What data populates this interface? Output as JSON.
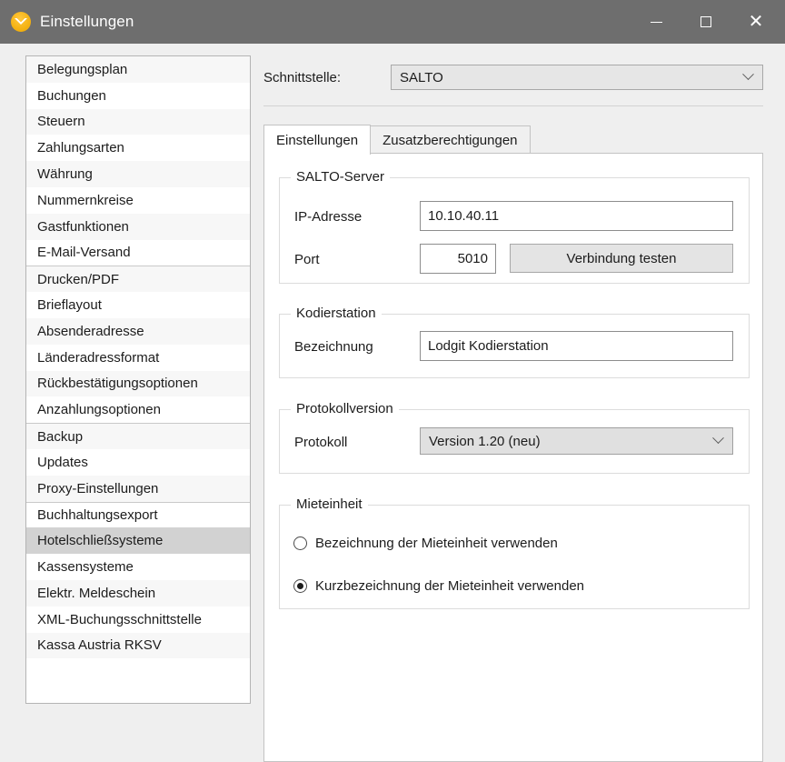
{
  "window": {
    "title": "Einstellungen",
    "icon": "lodgit-bird-icon",
    "minimize_label": "–",
    "maximize_label": "□",
    "close_label": "✕",
    "titlebar_color": "#6e6e6e"
  },
  "sidebar": {
    "items": [
      {
        "label": "Belegungsplan",
        "selected": false,
        "separator_above": false
      },
      {
        "label": "Buchungen",
        "selected": false,
        "separator_above": false
      },
      {
        "label": "Steuern",
        "selected": false,
        "separator_above": false
      },
      {
        "label": "Zahlungsarten",
        "selected": false,
        "separator_above": false
      },
      {
        "label": "Währung",
        "selected": false,
        "separator_above": false
      },
      {
        "label": "Nummernkreise",
        "selected": false,
        "separator_above": false
      },
      {
        "label": "Gastfunktionen",
        "selected": false,
        "separator_above": false
      },
      {
        "label": "E-Mail-Versand",
        "selected": false,
        "separator_above": false
      },
      {
        "label": "Drucken/PDF",
        "selected": false,
        "separator_above": true
      },
      {
        "label": "Brieflayout",
        "selected": false,
        "separator_above": false
      },
      {
        "label": "Absenderadresse",
        "selected": false,
        "separator_above": false
      },
      {
        "label": "Länderadressformat",
        "selected": false,
        "separator_above": false
      },
      {
        "label": "Rückbestätigungsoptionen",
        "selected": false,
        "separator_above": false
      },
      {
        "label": "Anzahlungsoptionen",
        "selected": false,
        "separator_above": false
      },
      {
        "label": "Backup",
        "selected": false,
        "separator_above": true
      },
      {
        "label": "Updates",
        "selected": false,
        "separator_above": false
      },
      {
        "label": "Proxy-Einstellungen",
        "selected": false,
        "separator_above": false
      },
      {
        "label": "Buchhaltungsexport",
        "selected": false,
        "separator_above": true
      },
      {
        "label": "Hotelschließsysteme",
        "selected": true,
        "separator_above": false
      },
      {
        "label": "Kassensysteme",
        "selected": false,
        "separator_above": false
      },
      {
        "label": "Elektr. Meldeschein",
        "selected": false,
        "separator_above": false
      },
      {
        "label": "XML-Buchungsschnittstelle",
        "selected": false,
        "separator_above": false
      },
      {
        "label": "Kassa Austria RKSV",
        "selected": false,
        "separator_above": false
      }
    ]
  },
  "main": {
    "interface": {
      "label": "Schnittstelle:",
      "value": "SALTO",
      "caret": "chevron-down-icon"
    },
    "tabs": [
      {
        "label": "Einstellungen",
        "active": true
      },
      {
        "label": "Zusatzberechtigungen",
        "active": false
      }
    ],
    "groups": {
      "server": {
        "legend": "SALTO-Server",
        "ip_label": "IP-Adresse",
        "ip_value": "10.10.40.11",
        "port_label": "Port",
        "port_value": "5010",
        "test_button": "Verbindung testen"
      },
      "station": {
        "legend": "Kodierstation",
        "name_label": "Bezeichnung",
        "name_value": "Lodgit Kodierstation"
      },
      "protocol": {
        "legend": "Protokollversion",
        "proto_label": "Protokoll",
        "proto_value": "Version 1.20 (neu)",
        "caret": "chevron-down-icon"
      },
      "unit": {
        "legend": "Mieteinheit",
        "options": [
          {
            "label": "Bezeichnung der Mieteinheit verwenden",
            "checked": false
          },
          {
            "label": "Kurzbezeichnung der Mieteinheit verwenden",
            "checked": true
          }
        ]
      }
    }
  }
}
